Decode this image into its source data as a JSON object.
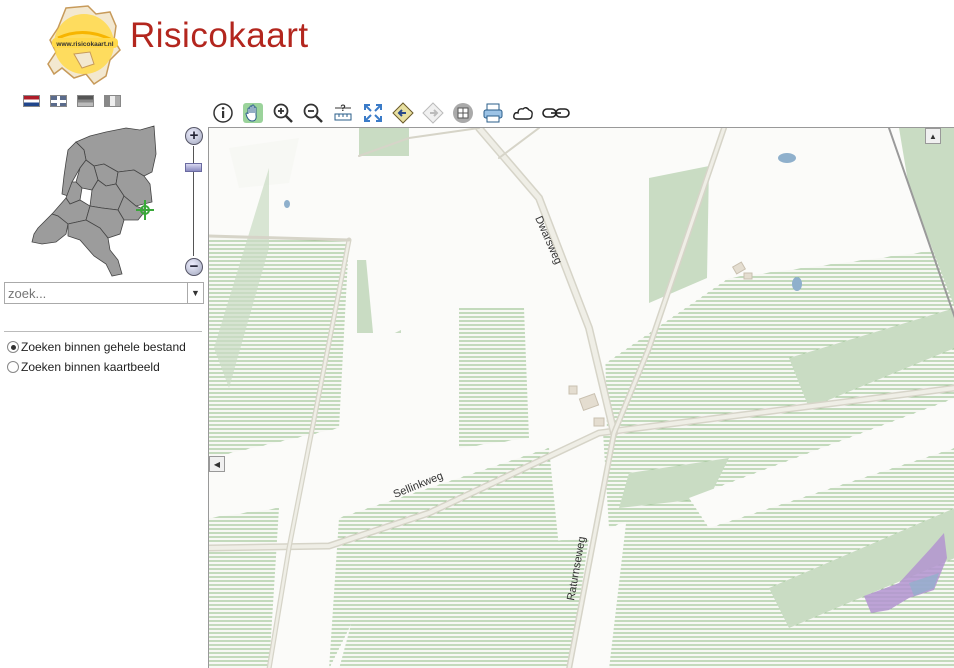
{
  "app": {
    "brand_name": "Risicokaart",
    "logo_text": "www.risicokaart.nl"
  },
  "languages": [
    "nl-flag-icon",
    "uk-flag-icon",
    "de-flag-icon",
    "fr-flag-icon"
  ],
  "search": {
    "placeholder": "zoek..."
  },
  "search_scope": {
    "options": [
      {
        "label": "Zoeken binnen gehele bestand",
        "checked": true
      },
      {
        "label": "Zoeken binnen kaartbeeld",
        "checked": false
      }
    ]
  },
  "zoom": {
    "in_label": "+",
    "out_label": "−"
  },
  "toolbar": {
    "tools": [
      "info-icon",
      "pan-hand-icon",
      "zoom-in-icon",
      "zoom-out-icon",
      "measure-icon",
      "full-extent-icon",
      "back-icon",
      "forward-icon",
      "layers-icon",
      "print-icon",
      "cloud-icon",
      "link-icon"
    ]
  },
  "map": {
    "street_labels": [
      "Dwarsweg",
      "Sellinkweg",
      "Raturnseweg"
    ],
    "colors": {
      "forest": "#c9dcc3",
      "forest_line": "#8fbb85",
      "road": "#e3e1d6",
      "water": "#8fb0cc",
      "hazard": "#b394d0"
    }
  }
}
